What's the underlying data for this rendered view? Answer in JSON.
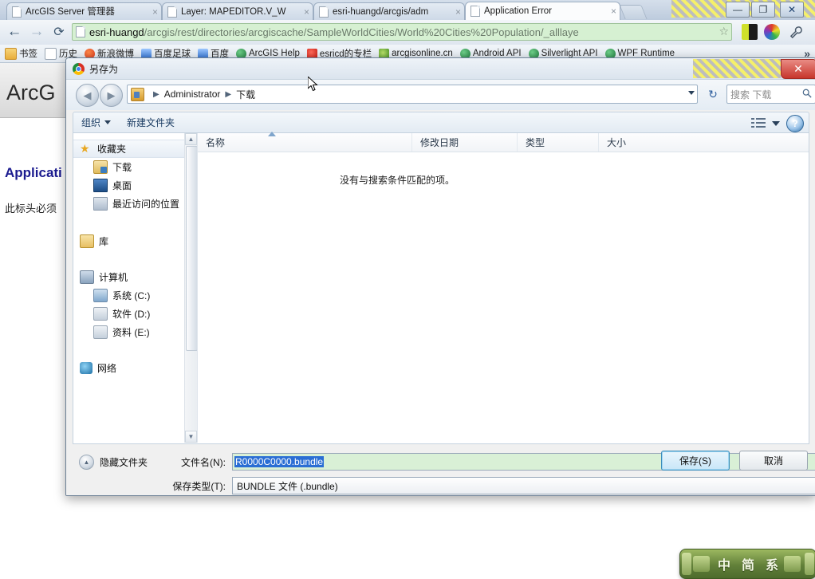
{
  "browser": {
    "tabs": [
      {
        "label": "ArcGIS Server 管理器",
        "close": "×",
        "active": false
      },
      {
        "label": "Layer: MAPEDITOR.V_W",
        "close": "×",
        "active": false
      },
      {
        "label": "esri-huangd/arcgis/adm",
        "close": "×",
        "active": false
      },
      {
        "label": "Application Error",
        "close": "×",
        "active": true
      }
    ],
    "window_controls": {
      "minimize": "—",
      "maximize": "❐",
      "close": "✕"
    },
    "nav": {
      "back": "←",
      "forward": "→",
      "reload": "⟳"
    },
    "omnibox": {
      "host": "esri-huangd",
      "rest": "/arcgis/rest/directories/arcgiscache/SampleWorldCities/World%20Cities%20Population/_alllaye",
      "star_icon": "☆"
    },
    "extensions": {
      "wrench": "🔧"
    },
    "bookmarks": {
      "items": [
        {
          "label": "书签",
          "icon": "folder"
        },
        {
          "label": "历史",
          "icon": "doc"
        },
        {
          "label": "新浪微博",
          "icon": "weibo"
        },
        {
          "label": "百度足球",
          "icon": "paw"
        },
        {
          "label": "百度",
          "icon": "paw"
        },
        {
          "label": "ArcGIS Help",
          "icon": "globe"
        },
        {
          "label": "esricd的专栏",
          "icon": "red"
        },
        {
          "label": "arcgisonline.cn",
          "icon": "leaf"
        },
        {
          "label": "Android API",
          "icon": "globe"
        },
        {
          "label": "Silverlight API",
          "icon": "globe"
        },
        {
          "label": "WPF Runtime",
          "icon": "globe"
        }
      ],
      "overflow": "»"
    }
  },
  "page": {
    "logo": "ArcG",
    "error_heading": "Applicati",
    "error_text": "此标头必须"
  },
  "dialog": {
    "title": "另存为",
    "close_label": "✕",
    "nav": {
      "back": "◀",
      "forward": "▶",
      "refresh": "↻"
    },
    "breadcrumb": {
      "items": [
        "Administrator",
        "下载"
      ],
      "separator": "▶",
      "dropdown_icon": "▼"
    },
    "search": {
      "placeholder": "搜索 下载",
      "icon": "🔍"
    },
    "toolbar": {
      "organize": "组织",
      "new_folder": "新建文件夹",
      "views_icon": "views-icon",
      "help_icon": "?"
    },
    "sidebar": {
      "groups": [
        {
          "items": [
            {
              "label": "收藏夹",
              "icon": "star",
              "level": 0,
              "selected": true
            },
            {
              "label": "下载",
              "icon": "dl",
              "level": 1,
              "selected": false
            },
            {
              "label": "桌面",
              "icon": "desk",
              "level": 1,
              "selected": false
            },
            {
              "label": "最近访问的位置",
              "icon": "recent",
              "level": 1,
              "selected": false
            }
          ]
        },
        {
          "items": [
            {
              "label": "库",
              "icon": "lib",
              "level": 0,
              "selected": false
            }
          ]
        },
        {
          "items": [
            {
              "label": "计算机",
              "icon": "pc",
              "level": 0,
              "selected": false
            },
            {
              "label": "系统 (C:)",
              "icon": "sysdrive",
              "level": 1,
              "selected": false
            },
            {
              "label": "软件 (D:)",
              "icon": "drive",
              "level": 1,
              "selected": false
            },
            {
              "label": "资料 (E:)",
              "icon": "drive",
              "level": 1,
              "selected": false
            }
          ]
        },
        {
          "items": [
            {
              "label": "网络",
              "icon": "net",
              "level": 0,
              "selected": false
            }
          ]
        }
      ],
      "scroll": {
        "up": "▲",
        "down": "▼"
      }
    },
    "filelist": {
      "columns": [
        "名称",
        "修改日期",
        "类型",
        "大小"
      ],
      "empty_message": "没有与搜索条件匹配的项。",
      "rows": []
    },
    "filename": {
      "label": "文件名(N):",
      "value": "R0000C0000.bundle",
      "caret": "▼"
    },
    "filetype": {
      "label": "保存类型(T):",
      "value": "BUNDLE 文件 (.bundle)",
      "caret": "▼"
    },
    "hide_folders": {
      "label": "隐藏文件夹",
      "icon": "▲"
    },
    "buttons": {
      "save": "保存(S)",
      "cancel": "取消"
    }
  },
  "ime": {
    "keyboard_icon": "⌨",
    "mode": "中",
    "shape": "简",
    "punct": "系",
    "tools_icon": "🌙"
  }
}
